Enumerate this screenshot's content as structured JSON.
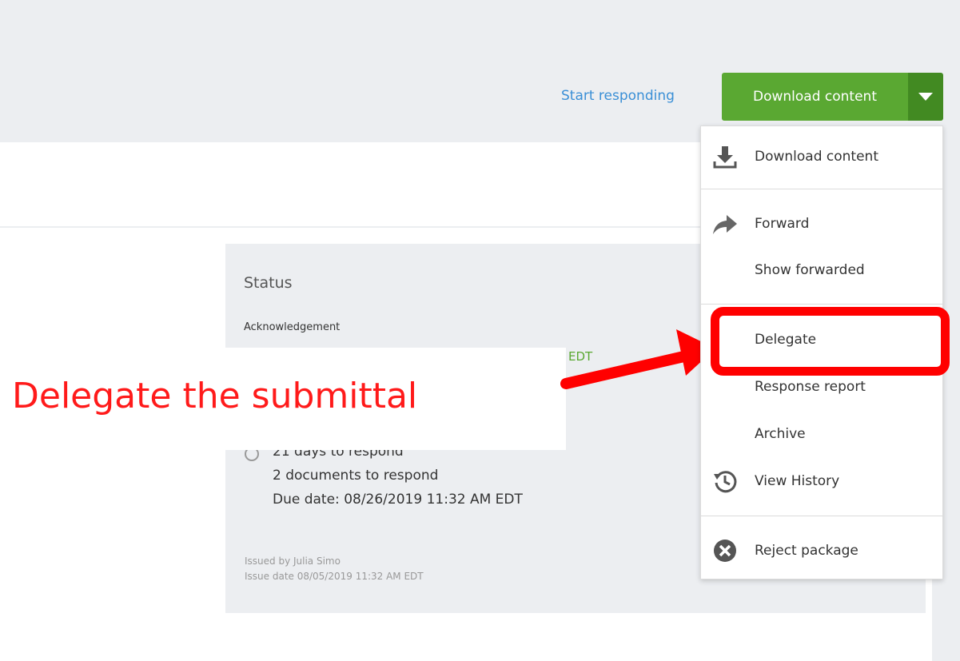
{
  "header": {
    "start_responding": "Start responding",
    "download_button": "Download content"
  },
  "menu": {
    "items": [
      {
        "label": "Download content",
        "icon": "download-icon"
      },
      {
        "label": "Forward",
        "icon": "forward-arrow-icon"
      },
      {
        "label": "Show forwarded"
      },
      {
        "label": "Delegate"
      },
      {
        "label": "Response report"
      },
      {
        "label": "Archive"
      },
      {
        "label": "View History",
        "icon": "history-icon"
      },
      {
        "label": "Reject package",
        "icon": "reject-icon"
      }
    ]
  },
  "status": {
    "title": "Status",
    "acknowledgement_label": "Acknowledgement",
    "acknowledgement_value_partial": "EDT",
    "days_to_respond": "21 days to respond",
    "documents_to_respond": "2 documents to respond",
    "due_date": "Due date: 08/26/2019 11:32 AM EDT",
    "issued_by": "Issued by Julia Simo",
    "issue_date": "Issue date 08/05/2019 11:32 AM EDT"
  },
  "annotation": {
    "text": "Delegate the submittal",
    "color": "#ff0000"
  },
  "colors": {
    "primary_green": "#5aa832",
    "link_blue": "#3a8fd6",
    "panel_gray": "#eceef1"
  }
}
